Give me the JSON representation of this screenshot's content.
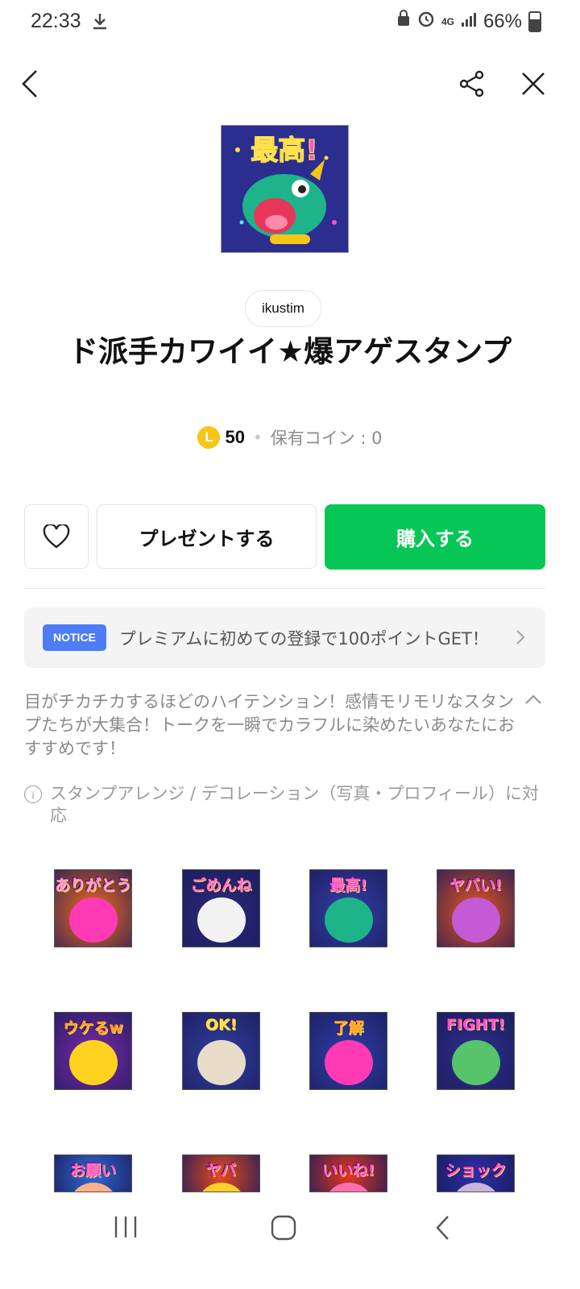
{
  "status_bar": {
    "time": "22:33",
    "battery": "66%",
    "network": "4G"
  },
  "top_nav": {
    "back_icon": "chevron-left-icon",
    "share_icon": "share-icon",
    "close_icon": "close-icon"
  },
  "product": {
    "image_label": "最高!",
    "author": "ikustim",
    "title": "ド派手カワイイ★爆アゲスタンプ",
    "coin_symbol": "L",
    "price": "50",
    "owned_coins": "保有コイン : 0"
  },
  "actions": {
    "favorite_icon": "heart-icon",
    "gift_label": "プレゼントする",
    "buy_label": "購入する",
    "buy_color": "#06c755"
  },
  "notice": {
    "badge": "NOTICE",
    "text": "プレミアムに初めての登録で100ポイントGET！",
    "badge_color": "#4e7cf5"
  },
  "description": {
    "text": "目がチカチカするほどのハイテンション！感情モリモリなスタンプたちが大集合！トークを一瞬でカラフルに染めたいあなたにおすすめです！"
  },
  "info": {
    "text": "スタンプアレンジ / デコレーション（写真・プロフィール）に対応"
  },
  "stickers": [
    {
      "label": "ありがとう",
      "bg": "#f26a1b",
      "fg": "#ff3ab4",
      "text_color": "#ff8fe0"
    },
    {
      "label": "ごめんね",
      "bg": "#2a2a7a",
      "fg": "#f2f2f2",
      "text_color": "#ff70d0"
    },
    {
      "label": "最高!",
      "bg": "#3240a8",
      "fg": "#1fb38a",
      "text_color": "#ff4fd8"
    },
    {
      "label": "ヤバい!",
      "bg": "#e8541f",
      "fg": "#c45ad6",
      "text_color": "#ff4fd8"
    },
    {
      "label": "ウケるw",
      "bg": "#7b2aa8",
      "fg": "#ffd21f",
      "text_color": "#ff9a2a"
    },
    {
      "label": "OK!",
      "bg": "#2f3f9e",
      "fg": "#e8dcc8",
      "text_color": "#ffe24a"
    },
    {
      "label": "了解",
      "bg": "#2d3fa8",
      "fg": "#ff3ab4",
      "text_color": "#ffa02a"
    },
    {
      "label": "FIGHT!",
      "bg": "#2b2f8a",
      "fg": "#56c46a",
      "text_color": "#ff4fd8"
    },
    {
      "label": "お願い",
      "bg": "#2f6ad6",
      "fg": "#ffb08a",
      "text_color": "#ff4fd8"
    },
    {
      "label": "ヤバ",
      "bg": "#e84a1f",
      "fg": "#ffcf2a",
      "text_color": "#ff4fd8"
    },
    {
      "label": "いいね!",
      "bg": "#e8361f",
      "fg": "#ff6fb0",
      "text_color": "#ff4fd8"
    },
    {
      "label": "ショック",
      "bg": "#2b2fa8",
      "fg": "#c9b5d8",
      "text_color": "#ff4fd8"
    }
  ],
  "nav_bar": {
    "recents_icon": "recents-icon",
    "home_icon": "home-icon",
    "back_icon": "back-icon"
  }
}
